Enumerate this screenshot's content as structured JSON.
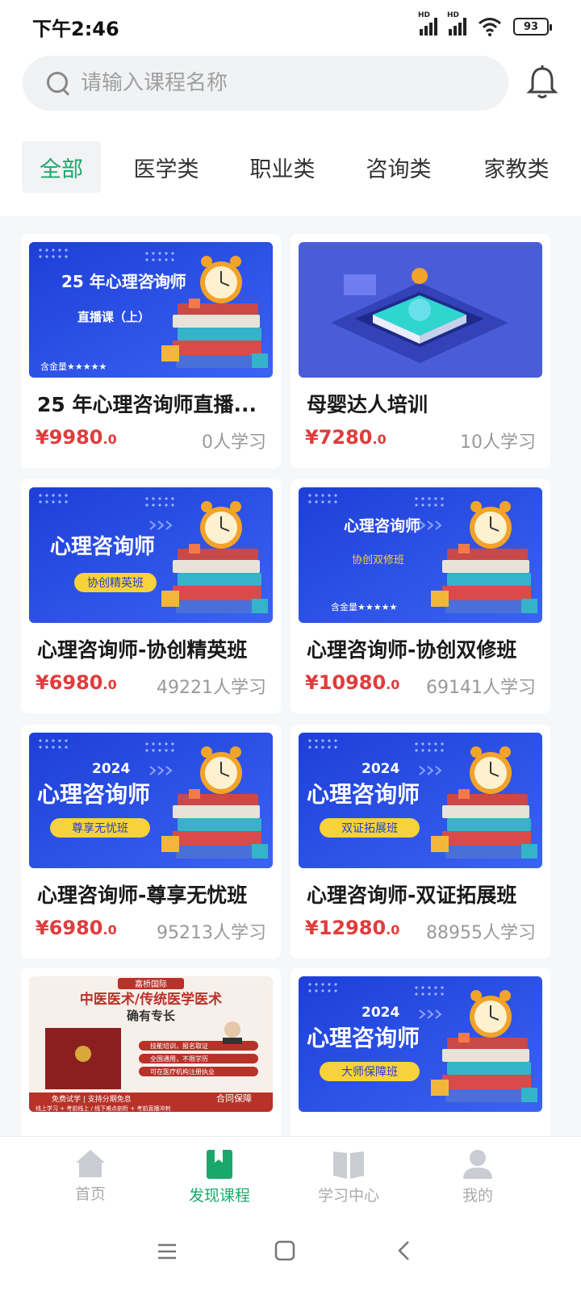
{
  "status": {
    "time": "下午2:46",
    "battery": "93",
    "hd1": "HD",
    "hd2": "HD"
  },
  "search": {
    "placeholder": "请输入课程名称"
  },
  "tabs": [
    "全部",
    "医学类",
    "职业类",
    "咨询类",
    "家教类"
  ],
  "courses": [
    {
      "title": "25 年心理咨询师直播...",
      "price": "¥9980",
      "decimal": ".0",
      "learners": "0人学习",
      "banner": {
        "line1": "25 年心理咨询师",
        "line2": "直播课（上）",
        "tag": "含金量★★★★★"
      }
    },
    {
      "title": "母婴达人培训",
      "price": "¥7280",
      "decimal": ".0",
      "learners": "10人学习"
    },
    {
      "title": "心理咨询师-协创精英班",
      "price": "¥6980",
      "decimal": ".0",
      "learners": "49221人学习",
      "banner": {
        "line1": "心理咨询师",
        "pill": "协创精英班"
      }
    },
    {
      "title": "心理咨询师-协创双修班",
      "price": "¥10980",
      "decimal": ".0",
      "learners": "69141人学习",
      "banner": {
        "line1": "心理咨询师",
        "line2": "协创双修班",
        "tag": "含金量★★★★★"
      }
    },
    {
      "title": "心理咨询师-尊享无忧班",
      "price": "¥6980",
      "decimal": ".0",
      "learners": "95213人学习",
      "banner": {
        "year": "2024",
        "line1": "心理咨询师",
        "pill": "尊享无忧班"
      }
    },
    {
      "title": "心理咨询师-双证拓展班",
      "price": "¥12980",
      "decimal": ".0",
      "learners": "88955人学习",
      "banner": {
        "year": "2024",
        "line1": "心理咨询师",
        "pill": "双证拓展班"
      }
    },
    {
      "banner": {
        "brand": "嘉桥国际",
        "line1": "中医医术/传统医学医术",
        "line2": "确有专长",
        "items": [
          "技能培训，报名取证",
          "全国通用，不限学历",
          "可在医疗机构注册执业"
        ],
        "f1": "免费试学 | 支持分期免息",
        "f2": "合同保障",
        "f3": "线上学习 + 考前线上 / 线下难点剖析 + 考前直播冲刺"
      }
    },
    {
      "banner": {
        "year": "2024",
        "line1": "心理咨询师",
        "pill": "大师保障班"
      }
    }
  ],
  "nav": [
    {
      "label": "首页",
      "icon": "home-icon"
    },
    {
      "label": "发现课程",
      "icon": "bookmark-icon",
      "active": true
    },
    {
      "label": "学习中心",
      "icon": "open-book-icon"
    },
    {
      "label": "我的",
      "icon": "person-icon"
    }
  ],
  "colors": {
    "accent": "#1aa86a",
    "price": "#e03c3c",
    "banner_blue": "#2f4fe0"
  }
}
